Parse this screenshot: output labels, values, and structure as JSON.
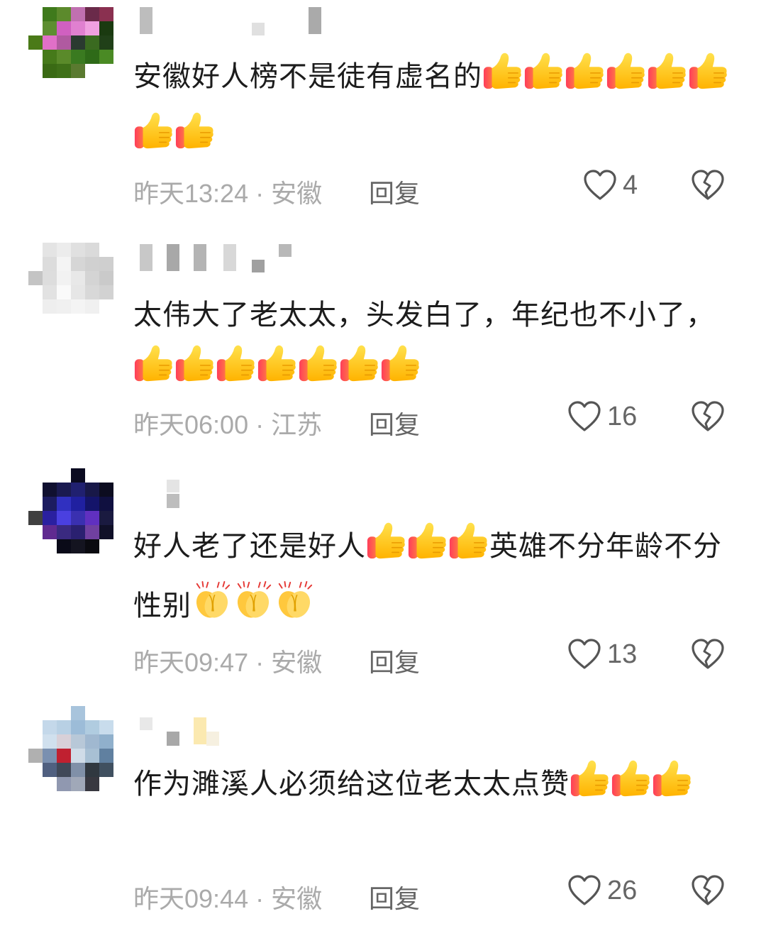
{
  "comments": [
    {
      "text": "安徽好人榜不是徒有虚名的",
      "emoji": "thumbs-up",
      "emoji_count": 8,
      "time": "昨天13:24",
      "location": "安徽",
      "reply": "回复",
      "likes": "4"
    },
    {
      "text": "太伟大了老太太，头发白了，年纪也不小了，",
      "emoji": "thumbs-up",
      "emoji_count": 7,
      "time": "昨天06:00",
      "location": "江苏",
      "reply": "回复",
      "likes": "16"
    },
    {
      "text_a": "好人老了还是好人",
      "emoji_a": "thumbs-up",
      "emoji_a_count": 3,
      "text_b": "英雄不分年龄不分性别",
      "emoji_b": "clapping-hands",
      "emoji_b_count": 3,
      "time": "昨天09:47",
      "location": "安徽",
      "reply": "回复",
      "likes": "13"
    },
    {
      "text": "作为濉溪人必须给这位老太太点赞",
      "emoji": "thumbs-up",
      "emoji_count": 3,
      "time": "昨天09:44",
      "location": "安徽",
      "reply": "回复",
      "likes": "26"
    }
  ],
  "meta_separator": " · ",
  "icons": {
    "like": "heart-outline-icon",
    "dislike": "broken-heart-icon",
    "thumbs": "thumbs-up-emoji",
    "clap": "clapping-hands-emoji"
  },
  "colors": {
    "meta": "#aaaaaa",
    "reply": "#666666",
    "icon": "#555555",
    "text": "#1c1c1c"
  }
}
